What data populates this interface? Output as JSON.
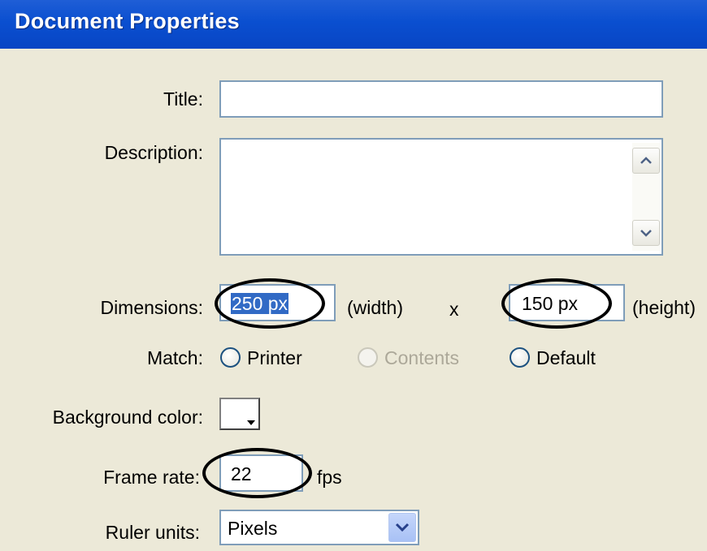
{
  "window": {
    "title": "Document Properties"
  },
  "form": {
    "title_label": "Title:",
    "title_value": "",
    "description_label": "Description:",
    "description_value": "",
    "dimensions_label": "Dimensions:",
    "width_value": "250 px",
    "width_suffix": "(width)",
    "times": "x",
    "height_value": "150 px",
    "height_suffix": "(height)",
    "match_label": "Match:",
    "match_options": [
      {
        "label": "Printer",
        "enabled": true
      },
      {
        "label": "Contents",
        "enabled": false
      },
      {
        "label": "Default",
        "enabled": true
      }
    ],
    "background_label": "Background color:",
    "background_color": "#ffffff",
    "frame_rate_label": "Frame rate:",
    "frame_rate_value": "22",
    "frame_rate_unit": "fps",
    "ruler_label": "Ruler units:",
    "ruler_value": "Pixels"
  },
  "colors": {
    "titlebar": "#0a4fd0",
    "dialog_bg": "#ece9d8",
    "field_border": "#7f9db9",
    "selection": "#316ac5"
  }
}
